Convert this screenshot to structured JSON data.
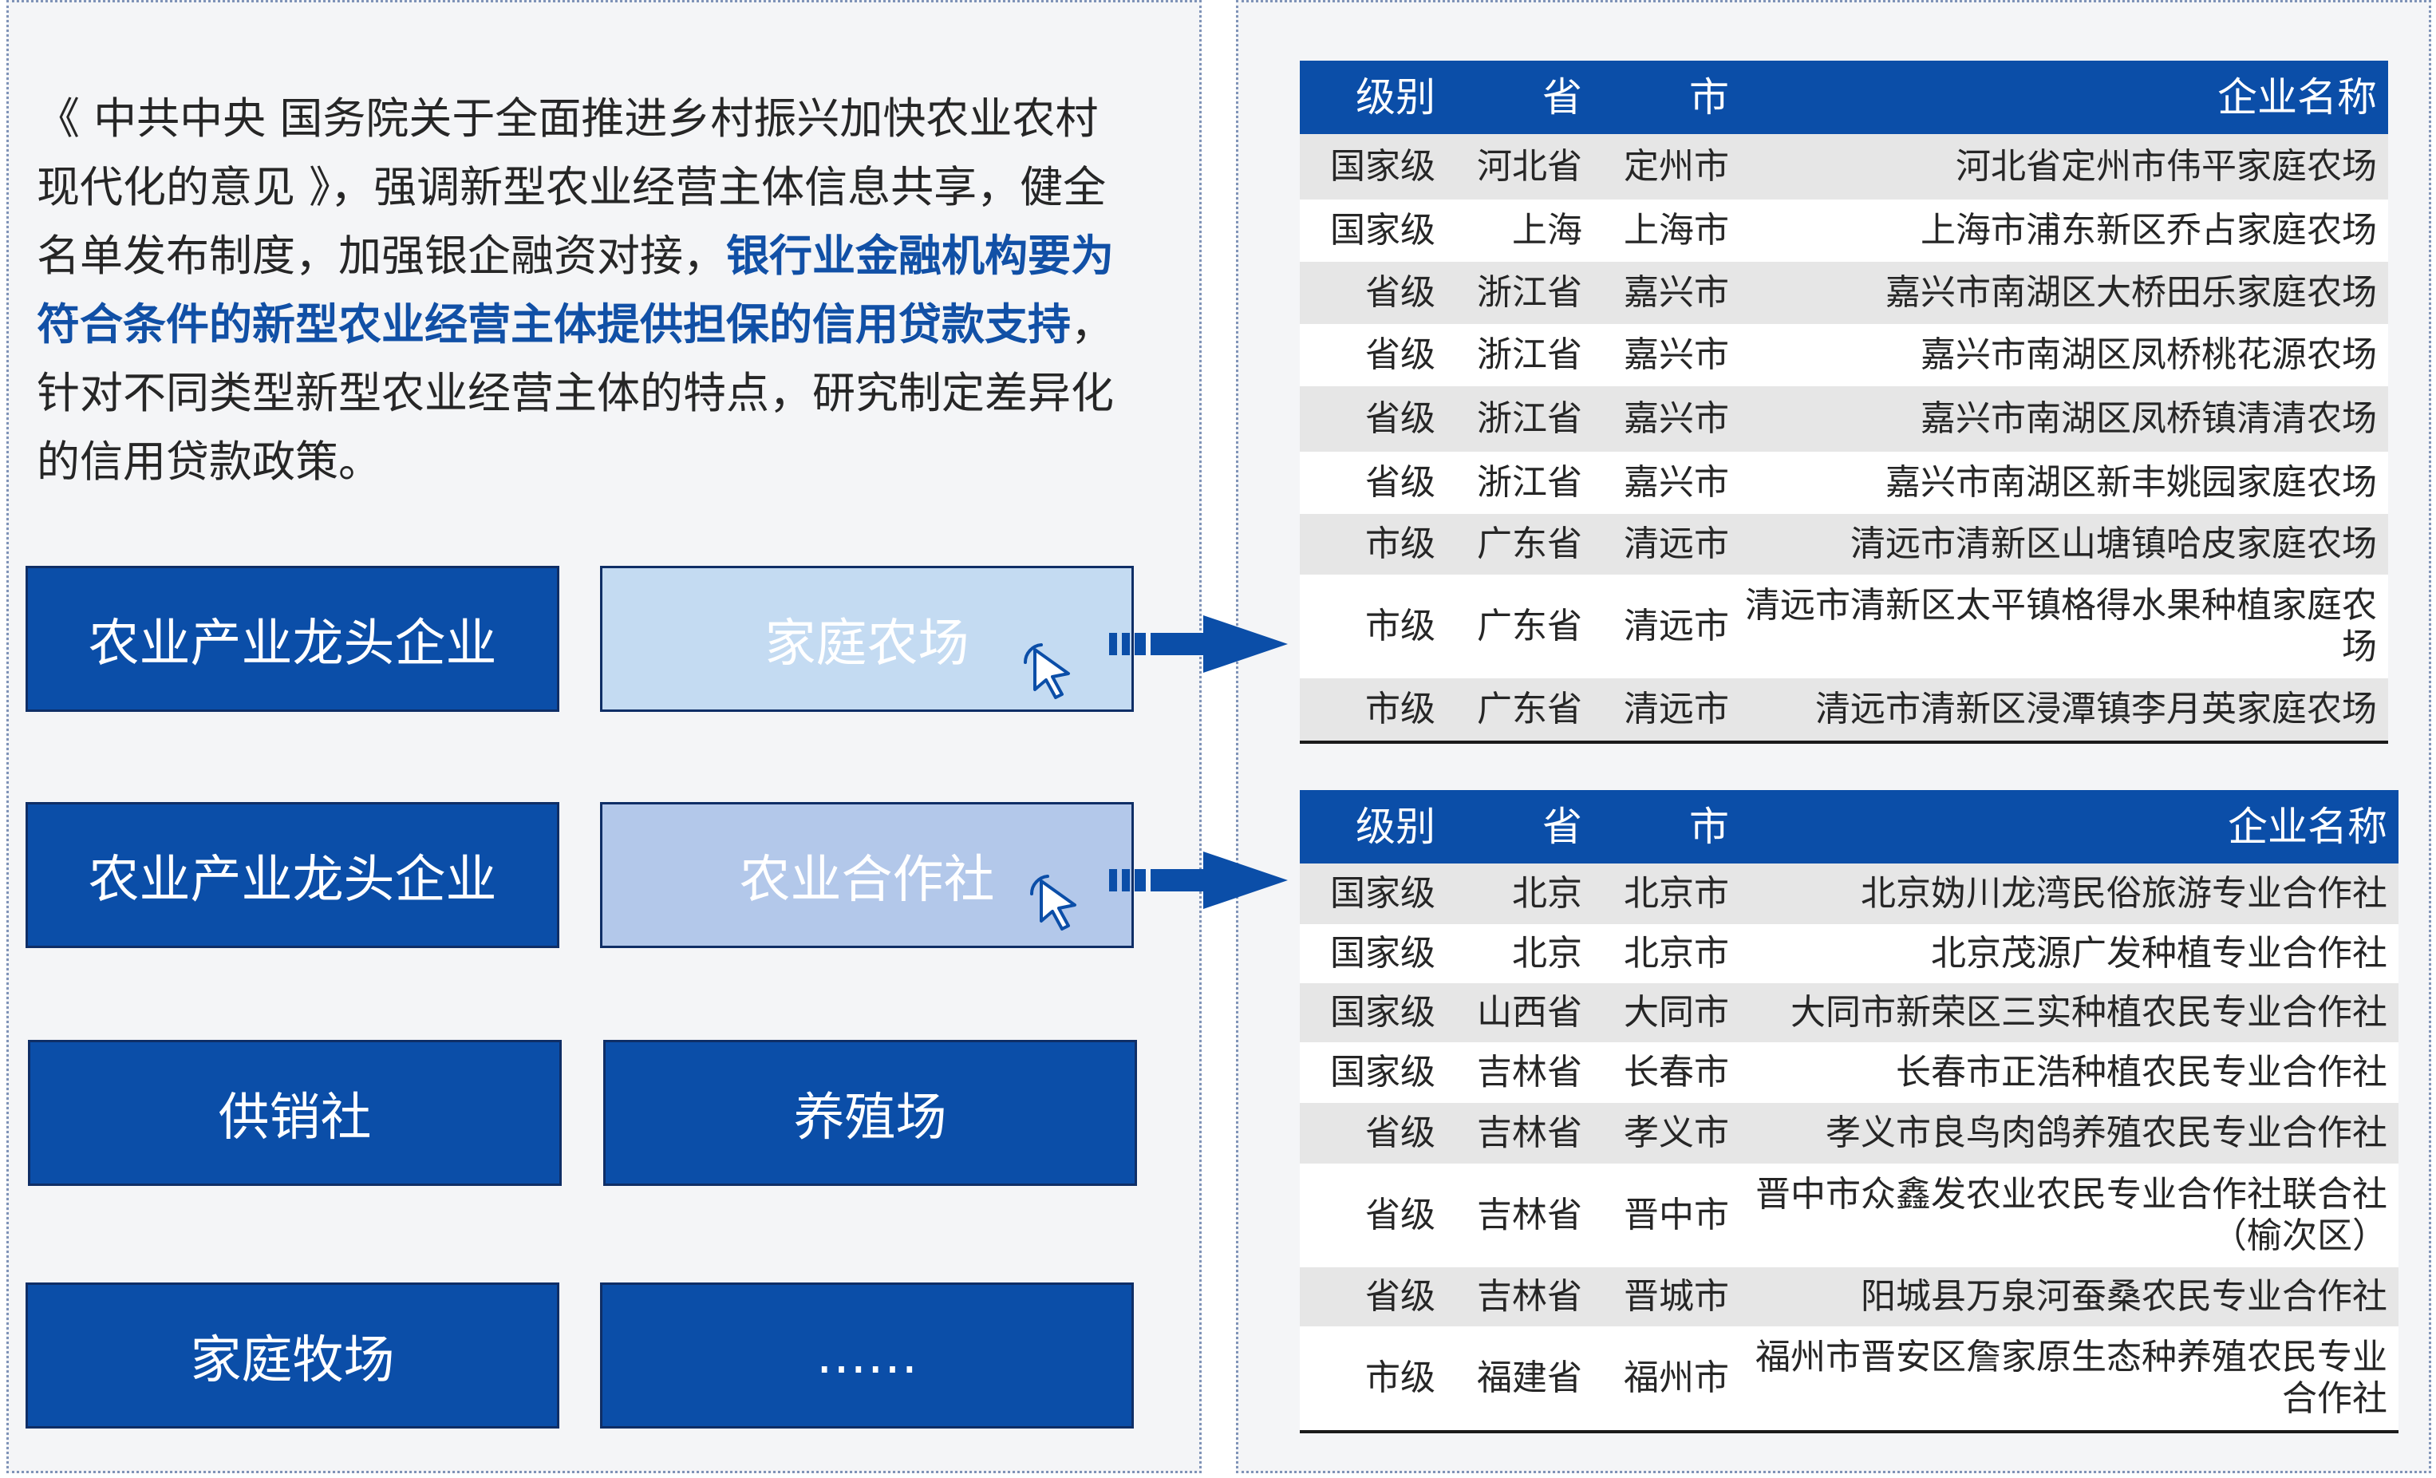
{
  "intro": {
    "part1": "《 中共中央 国务院关于全面推进乡村振兴加快农业农村现代化的意见 》，强调新型农业经营主体信息共享，健全名单发布制度，加强银企融资对接，",
    "highlight": "银行业金融机构要为符合条件的新型农业经营主体提供担保的信用贷款支持",
    "part2": "，针对不同类型新型农业经营主体的特点，研究制定差异化的信用贷款政策。"
  },
  "categories": {
    "r1_left": "农业产业龙头企业",
    "r1_right": "家庭农场",
    "r2_left": "农业产业龙头企业",
    "r2_right": "农业合作社",
    "r3_left": "供销社",
    "r3_right": "养殖场",
    "r4_left": "家庭牧场",
    "r4_right": "……"
  },
  "table1": {
    "headers": [
      "级别",
      "省",
      "市",
      "企业名称"
    ],
    "rows": [
      [
        "国家级",
        "河北省",
        "定州市",
        "河北省定州市伟平家庭农场"
      ],
      [
        "国家级",
        "上海",
        "上海市",
        "上海市浦东新区乔占家庭农场"
      ],
      [
        "省级",
        "浙江省",
        "嘉兴市",
        "嘉兴市南湖区大桥田乐家庭农场"
      ],
      [
        "省级",
        "浙江省",
        "嘉兴市",
        "嘉兴市南湖区凤桥桃花源农场"
      ],
      [
        "省级",
        "浙江省",
        "嘉兴市",
        "嘉兴市南湖区凤桥镇清清农场"
      ],
      [
        "省级",
        "浙江省",
        "嘉兴市",
        "嘉兴市南湖区新丰姚园家庭农场"
      ],
      [
        "市级",
        "广东省",
        "清远市",
        "清远市清新区山塘镇哈皮家庭农场"
      ],
      [
        "市级",
        "广东省",
        "清远市",
        "清远市清新区太平镇格得水果种植家庭农场"
      ],
      [
        "市级",
        "广东省",
        "清远市",
        "清远市清新区浸潭镇李月英家庭农场"
      ]
    ]
  },
  "table2": {
    "headers": [
      "级别",
      "省",
      "市",
      "企业名称"
    ],
    "rows": [
      [
        "国家级",
        "北京",
        "北京市",
        "北京妫川龙湾民俗旅游专业合作社"
      ],
      [
        "国家级",
        "北京",
        "北京市",
        "北京茂源广发种植专业合作社"
      ],
      [
        "国家级",
        "山西省",
        "大同市",
        "大同市新荣区三实种植农民专业合作社"
      ],
      [
        "国家级",
        "吉林省",
        "长春市",
        "长春市正浩种植农民专业合作社"
      ],
      [
        "省级",
        "吉林省",
        "孝义市",
        "孝义市良鸟肉鸽养殖农民专业合作社"
      ],
      [
        "省级",
        "吉林省",
        "晋中市",
        "晋中市众鑫发农业农民专业合作社联合社（榆次区）"
      ],
      [
        "省级",
        "吉林省",
        "晋城市",
        "阳城县万泉河蚕桑农民专业合作社"
      ],
      [
        "市级",
        "福建省",
        "福州市",
        "福州市晋安区詹家原生态种养殖农民专业合作社"
      ]
    ]
  },
  "colors": {
    "primary": "#0b4ea8",
    "highlight_text": "#1150a6",
    "light_box_1": "#c4dbf2",
    "light_box_2": "#b3c8ea",
    "panel_bg": "#f4f5f7"
  }
}
